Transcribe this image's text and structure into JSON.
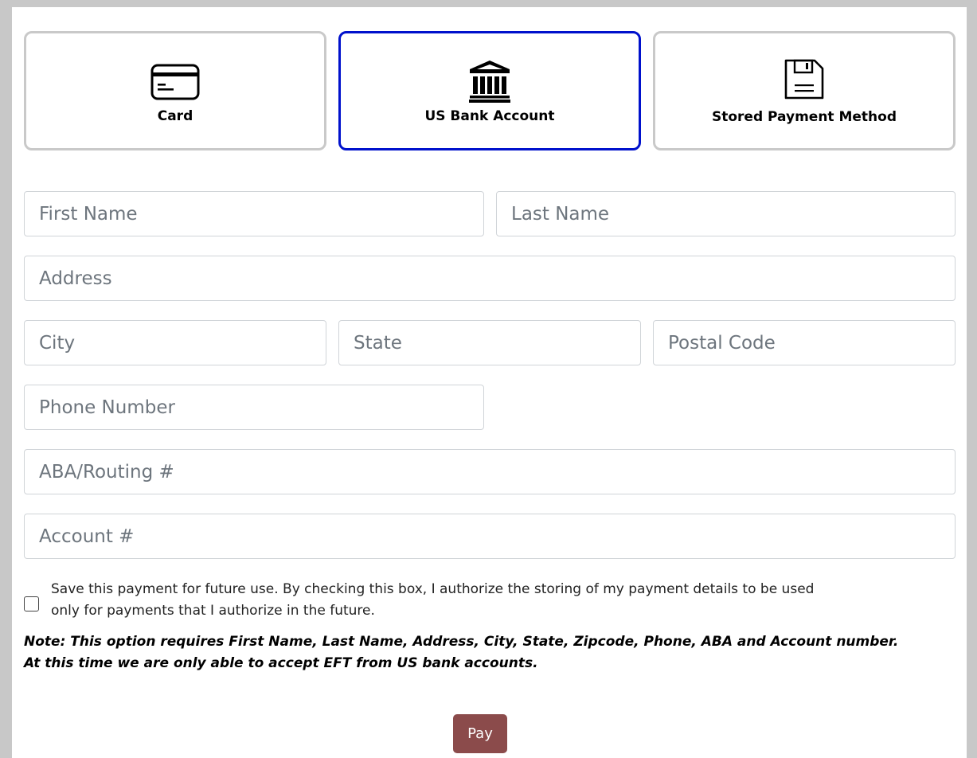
{
  "payment_methods": [
    {
      "label": "Card",
      "icon": "credit-card-icon",
      "active": false
    },
    {
      "label": "US Bank Account",
      "icon": "bank-icon",
      "active": true
    },
    {
      "label": "Stored Payment Method",
      "icon": "floppy-disk-icon",
      "active": false
    }
  ],
  "form": {
    "first_name": {
      "placeholder": "First Name",
      "value": ""
    },
    "last_name": {
      "placeholder": "Last Name",
      "value": ""
    },
    "address": {
      "placeholder": "Address",
      "value": ""
    },
    "city": {
      "placeholder": "City",
      "value": ""
    },
    "state": {
      "placeholder": "State",
      "value": ""
    },
    "postal_code": {
      "placeholder": "Postal Code",
      "value": ""
    },
    "phone": {
      "placeholder": "Phone Number",
      "value": ""
    },
    "routing": {
      "placeholder": "ABA/Routing #",
      "value": ""
    },
    "account": {
      "placeholder": "Account #",
      "value": ""
    }
  },
  "save_payment": {
    "checked": false,
    "text": "Save this payment for future use. By checking this box, I authorize the storing of my payment details to be used only for payments that I authorize in the future."
  },
  "note": {
    "line1": "Note: This option requires First Name, Last Name, Address, City, State, Zipcode, Phone, ABA and Account number.",
    "line2": "At this time we are only able to accept EFT from US bank accounts."
  },
  "pay_button": {
    "label": "Pay"
  },
  "colors": {
    "active_border": "#0011cc",
    "inactive_border": "#c9c9c9",
    "pay_button": "#8b4b4b",
    "page_background": "#c8c8c8"
  }
}
